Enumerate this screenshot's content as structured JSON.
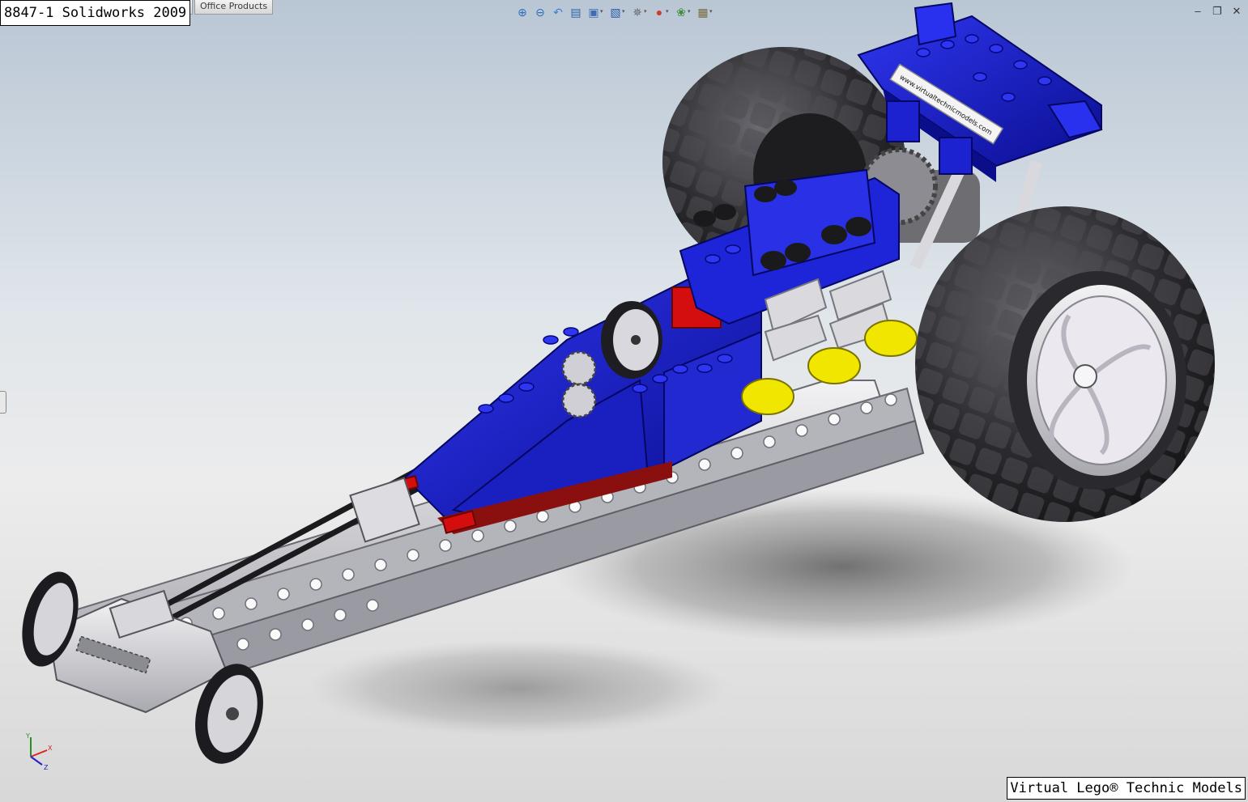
{
  "captions": {
    "top": "8847-1 Solidworks 2009",
    "bottom": "Virtual Lego® Technic Models"
  },
  "tabs": {
    "previous": "",
    "office": "Office Products"
  },
  "view_toolbar": [
    {
      "name": "zoom-to-fit-icon",
      "glyph": "⊕"
    },
    {
      "name": "zoom-to-area-icon",
      "glyph": "⊖"
    },
    {
      "name": "previous-view-icon",
      "glyph": "↶"
    },
    {
      "name": "section-view-icon",
      "glyph": "▤"
    },
    {
      "name": "view-orientation-icon",
      "glyph": "▣"
    },
    {
      "name": "display-style-icon",
      "glyph": "▧"
    },
    {
      "name": "hide-show-items-icon",
      "glyph": "✵"
    },
    {
      "name": "edit-appearance-icon",
      "glyph": "●"
    },
    {
      "name": "apply-scene-icon",
      "glyph": "❀"
    },
    {
      "name": "view-settings-icon",
      "glyph": "▦"
    }
  ],
  "window_controls": {
    "minimize": "–",
    "restore": "❐",
    "close": "✕"
  },
  "triad": {
    "x": "X",
    "y": "Y",
    "z": "Z"
  },
  "model": {
    "decal_text": "www.virtualtechnicmodels.com",
    "colors": {
      "blue": "#1c21c8",
      "blue_dark": "#0d1186",
      "red": "#d80f0f",
      "yellow": "#e8e000",
      "gray_beam": "#c9c9cf",
      "gray_dark": "#8f8f96",
      "tire": "#2b2b2e",
      "tire_light": "#505055",
      "rim": "#ece8f0"
    }
  }
}
